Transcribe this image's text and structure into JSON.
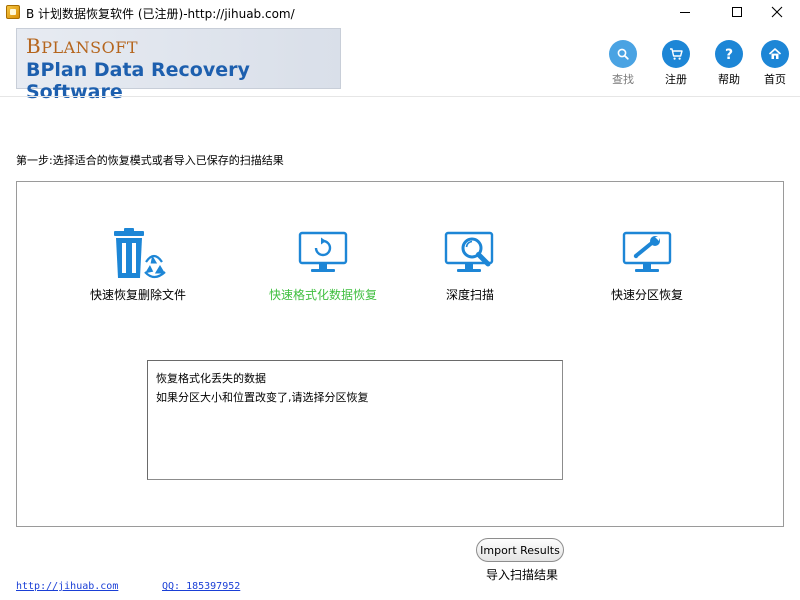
{
  "window": {
    "title": "B 计划数据恢复软件 (已注册)-http://jihuab.com/"
  },
  "header": {
    "brand": "BPLANSOFT",
    "brand_first": "B",
    "brand_rest": "PLANSOFT",
    "product": "BPlan Data Recovery Software",
    "buttons": [
      {
        "label": "查找",
        "icon": "search-icon"
      },
      {
        "label": "注册",
        "icon": "cart-icon"
      },
      {
        "label": "帮助",
        "icon": "help-icon"
      },
      {
        "label": "首页",
        "icon": "home-icon"
      }
    ]
  },
  "step": {
    "label": "第一步:选择适合的恢复模式或者导入已保存的扫描结果"
  },
  "modes": [
    {
      "label": "快速恢复删除文件",
      "icon": "recycle-bin-icon",
      "active": false
    },
    {
      "label": "快速格式化数据恢复",
      "icon": "monitor-refresh-icon",
      "active": true
    },
    {
      "label": "深度扫描",
      "icon": "monitor-magnifier-icon",
      "active": false
    },
    {
      "label": "快速分区恢复",
      "icon": "monitor-wrench-icon",
      "active": false
    }
  ],
  "description": {
    "line1": "恢复格式化丢失的数据",
    "line2": "如果分区大小和位置改变了,请选择分区恢复"
  },
  "import": {
    "button_label": "Import Results",
    "label": "导入扫描结果"
  },
  "footer": {
    "website": "http://jihuab.com",
    "qq": "QQ: 185397952"
  },
  "colors": {
    "accent_blue": "#1d86d6",
    "active_green": "#3fbf3f",
    "brand_orange": "#b5651d",
    "product_blue": "#1d5fae"
  }
}
